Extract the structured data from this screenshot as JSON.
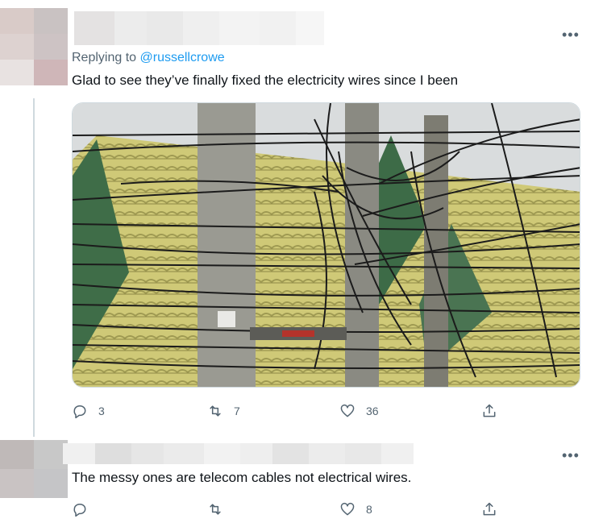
{
  "tweet1": {
    "replying_label": "Replying to",
    "replying_handle": "@russellcrowe",
    "text": "Glad to see they’ve finally fixed the electricity wires since I been",
    "actions": {
      "reply_count": "3",
      "retweet_count": "7",
      "like_count": "36"
    }
  },
  "tweet2": {
    "text": "The messy ones are telecom cables not electrical wires.",
    "actions": {
      "like_count": "8"
    }
  },
  "icons": {
    "more": "more-icon",
    "reply": "reply-icon",
    "retweet": "retweet-icon",
    "like": "heart-icon",
    "share": "share-icon"
  },
  "colors": {
    "accent": "#1d9bf0",
    "secondary_text": "#536471",
    "thread_line": "#cfd9de"
  }
}
